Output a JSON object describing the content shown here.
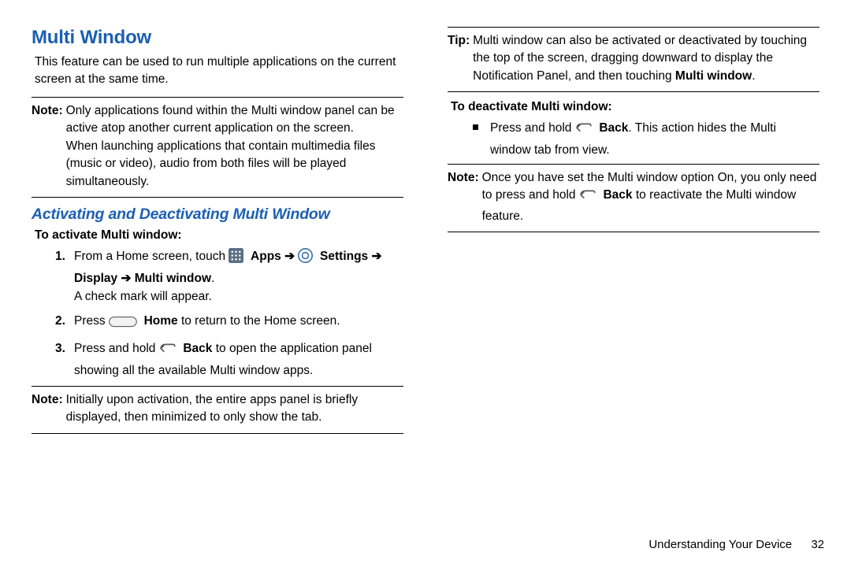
{
  "heading": "Multi Window",
  "intro": "This feature can be used to run multiple applications on the current screen at the same time.",
  "note1": {
    "label": "Note:",
    "text": "Only applications found within the Multi window panel can be active atop another current application on the screen.\nWhen launching applications that contain multimedia files (music or video), audio from both files will be played simultaneously."
  },
  "subheading": "Activating and Deactivating Multi Window",
  "activate_head": "To activate Multi window:",
  "steps": [
    {
      "pre": "From a Home screen, touch ",
      "apps": "Apps",
      "settings": "Settings",
      "trail": " ➔ Display ➔ Multi window",
      "period": ".",
      "line2": "A check mark will appear."
    },
    {
      "pre": "Press ",
      "home_bold": "Home",
      "trail": " to return to the Home screen."
    },
    {
      "pre": "Press and hold ",
      "back_bold": "Back",
      "trail": " to open the application panel showing all the available Multi window apps."
    }
  ],
  "note2": {
    "label": "Note:",
    "text": "Initially upon activation, the entire apps panel is briefly displayed, then minimized to only show the tab."
  },
  "tip": {
    "label": "Tip:",
    "text_a": "Multi window can also be activated or deactivated by touching the top of the screen, dragging downward to display the Notification Panel, and then touching ",
    "bold_tail": "Multi window",
    "period": "."
  },
  "deactivate_head": "To deactivate Multi window:",
  "deactivate_item": {
    "pre": "Press and hold ",
    "back_bold": "Back",
    "trail": ". This action hides the Multi window tab from view."
  },
  "note3": {
    "label": "Note:",
    "text_a": "Once you have set the Multi window option On, you only need to press and hold ",
    "back_bold": "Back",
    "text_b": " to reactivate the Multi window feature."
  },
  "footer": {
    "chapter": "Understanding Your Device",
    "page": "32"
  }
}
